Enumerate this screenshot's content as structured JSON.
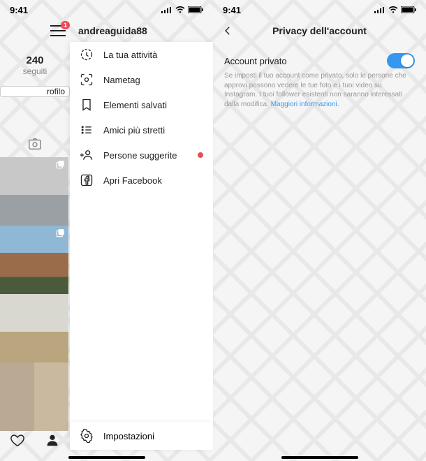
{
  "status": {
    "time": "9:41"
  },
  "left": {
    "hamburger_badge": "1",
    "username": "andreaguida88",
    "stat_number": "240",
    "stat_label": "seguiti",
    "edit_profile": "rofilo",
    "menu": [
      {
        "label": "La tua attività",
        "icon": "activity-icon"
      },
      {
        "label": "Nametag",
        "icon": "nametag-icon"
      },
      {
        "label": "Elementi salvati",
        "icon": "bookmark-icon"
      },
      {
        "label": "Amici più stretti",
        "icon": "close-friends-icon"
      },
      {
        "label": "Persone suggerite",
        "icon": "discover-people-icon",
        "badge": true
      },
      {
        "label": "Apri Facebook",
        "icon": "facebook-icon"
      }
    ],
    "settings_label": "Impostazioni"
  },
  "right": {
    "title": "Privacy dell'account",
    "toggle_label": "Account privato",
    "toggle_on": true,
    "description": "Se imposti il tuo account come privato, solo le persone che approvi possono vedere le tue foto e i tuoi video su Instagram. I tuoi follower esistenti non saranno interessati dalla modifica.",
    "learn_more": "Maggiori informazioni."
  }
}
